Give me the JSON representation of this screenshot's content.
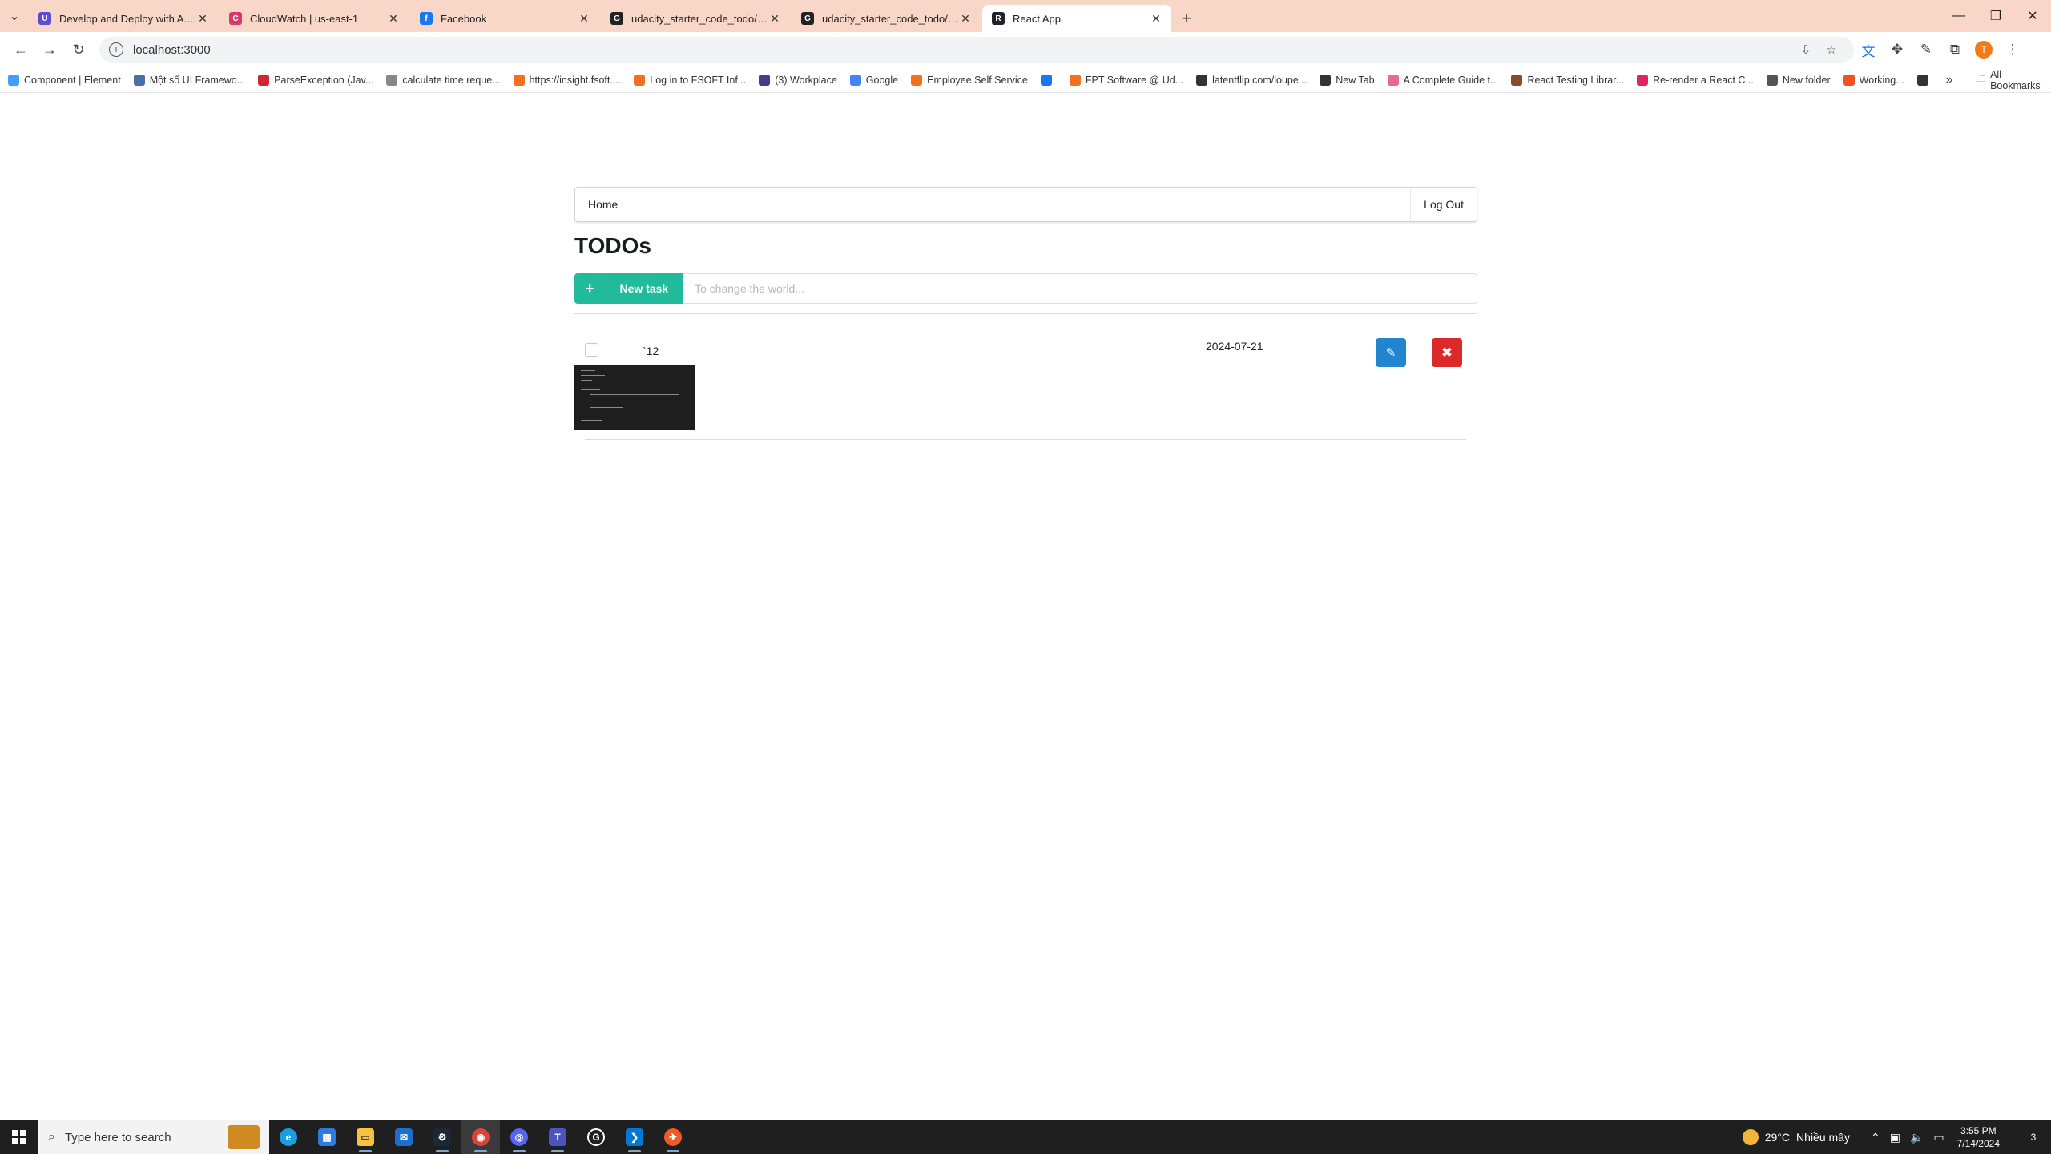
{
  "browser": {
    "tabs": [
      {
        "title": "Develop and Deploy with AWS",
        "favicon_color": "#5b4bd6",
        "favicon_glyph": "U"
      },
      {
        "title": "CloudWatch | us-east-1",
        "favicon_color": "#d63a6a",
        "favicon_glyph": "C"
      },
      {
        "title": "Facebook",
        "favicon_color": "#1877f2",
        "favicon_glyph": "f"
      },
      {
        "title": "udacity_starter_code_todo/clie",
        "favicon_color": "#222222",
        "favicon_glyph": "G"
      },
      {
        "title": "udacity_starter_code_todo/back",
        "favicon_color": "#222222",
        "favicon_glyph": "G"
      },
      {
        "title": "React App",
        "favicon_color": "#20232a",
        "favicon_glyph": "R",
        "active": true
      }
    ],
    "url": "localhost:3000",
    "profile_initial": "T",
    "bookmarks": [
      {
        "label": "Component | Element",
        "color": "#409eff"
      },
      {
        "label": "Một số UI Framewo...",
        "color": "#4a6fa5"
      },
      {
        "label": "ParseException (Jav...",
        "color": "#d0262d"
      },
      {
        "label": "calculate time reque...",
        "color": "#888888"
      },
      {
        "label": "https://insight.fsoft....",
        "color": "#f37021"
      },
      {
        "label": "Log in to FSOFT Inf...",
        "color": "#f37021"
      },
      {
        "label": "(3) Workplace",
        "color": "#4a3a8c"
      },
      {
        "label": "Google",
        "color": "#4285f4"
      },
      {
        "label": "Employee Self Service",
        "color": "#f37021"
      },
      {
        "label": "",
        "color": "#1877f2"
      },
      {
        "label": "FPT Software @ Ud...",
        "color": "#f37021"
      },
      {
        "label": "latentflip.com/loupe...",
        "color": "#333333"
      },
      {
        "label": "New Tab",
        "color": "#333333"
      },
      {
        "label": "A Complete Guide t...",
        "color": "#e86a92"
      },
      {
        "label": "React Testing Librar...",
        "color": "#8a4b2a"
      },
      {
        "label": "Re-render a React C...",
        "color": "#e0245e"
      },
      {
        "label": "New folder",
        "color": "#555555"
      },
      {
        "label": "Working...",
        "color": "#f25022"
      },
      {
        "label": "",
        "color": "#333333"
      }
    ],
    "all_bookmarks_label": "All Bookmarks"
  },
  "app": {
    "nav": {
      "home_label": "Home",
      "logout_label": "Log Out"
    },
    "title": "TODOs",
    "new_task": {
      "button_label": "New task",
      "placeholder": "To change the world..."
    },
    "todos": [
      {
        "name": "`12",
        "due_date": "2024-07-21",
        "done": false
      }
    ]
  },
  "taskbar": {
    "search_placeholder": "Type here to search",
    "weather": {
      "temp": "29°C",
      "condition": "Nhiều mây"
    },
    "time": "3:55 PM",
    "date": "7/14/2024",
    "notification_count": "3"
  }
}
